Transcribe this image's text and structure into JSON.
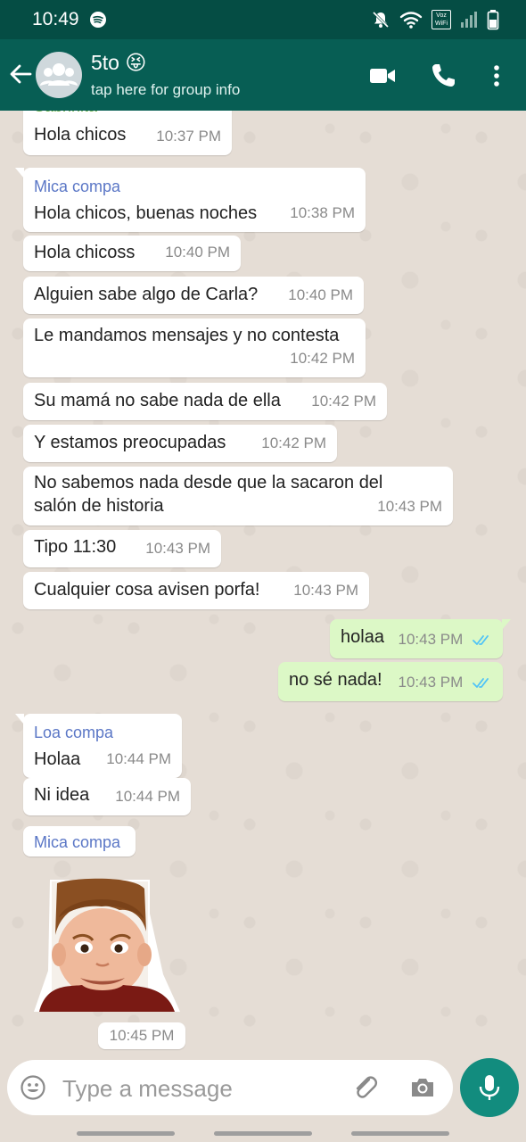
{
  "status_bar": {
    "time": "10:49",
    "icons": [
      "spotify-icon",
      "mute-icon",
      "wifi-icon",
      "vowifi-icon",
      "signal-icon",
      "battery-icon"
    ],
    "vowifi_label": "Voz WiFi"
  },
  "header": {
    "group_name": "5to 😝",
    "subtitle": "tap here for group info",
    "icons": [
      "back-arrow-icon",
      "group-avatar-icon",
      "video-call-icon",
      "voice-call-icon",
      "more-options-icon"
    ]
  },
  "messages": [
    {
      "sender": "Sabrinita",
      "text": "Hola chicos",
      "time": "10:37 PM",
      "direction": "in"
    },
    {
      "sender": "Mica compa",
      "text": "Hola chicos, buenas noches",
      "time": "10:38 PM",
      "direction": "in"
    },
    {
      "text": "Hola chicoss",
      "time": "10:40 PM",
      "direction": "in"
    },
    {
      "text": "Alguien sabe algo de Carla?",
      "time": "10:40 PM",
      "direction": "in"
    },
    {
      "text": "Le mandamos mensajes y no contesta",
      "time": "10:42 PM",
      "direction": "in"
    },
    {
      "text": "Su mamá no sabe nada de ella",
      "time": "10:42 PM",
      "direction": "in"
    },
    {
      "text": "Y estamos preocupadas",
      "time": "10:42 PM",
      "direction": "in"
    },
    {
      "text": "No sabemos nada desde que la sacaron del",
      "text2": "salón de historia",
      "time": "10:43 PM",
      "direction": "in"
    },
    {
      "text": "Tipo 11:30",
      "time": "10:43 PM",
      "direction": "in"
    },
    {
      "text": "Cualquier cosa avisen porfa!",
      "time": "10:43 PM",
      "direction": "in"
    },
    {
      "text": "holaa",
      "time": "10:43 PM",
      "direction": "out",
      "status": "read"
    },
    {
      "text": "no sé nada!",
      "time": "10:43 PM",
      "direction": "out",
      "status": "read"
    },
    {
      "sender": "Loa compa",
      "text": "Holaa",
      "time": "10:44 PM",
      "direction": "in"
    },
    {
      "text": "Ni idea",
      "time": "10:44 PM",
      "direction": "in"
    },
    {
      "sender": "Mica compa",
      "direction": "in"
    },
    {
      "type": "sticker",
      "sticker": "crying-boy-sticker",
      "time": "10:45 PM",
      "direction": "in"
    }
  ],
  "composer": {
    "placeholder": "Type a message",
    "icons": [
      "emoji-icon",
      "attach-icon",
      "camera-icon",
      "mic-icon"
    ]
  },
  "colors": {
    "header": "#075e54",
    "status_bar": "#054d44",
    "chat_bg": "#e5ddd5",
    "outgoing": "#dcf8c6",
    "incoming": "#ffffff",
    "mic_button": "#128c7e",
    "sender_name": "#5b77c6",
    "read_ticks": "#4fc3f7"
  }
}
